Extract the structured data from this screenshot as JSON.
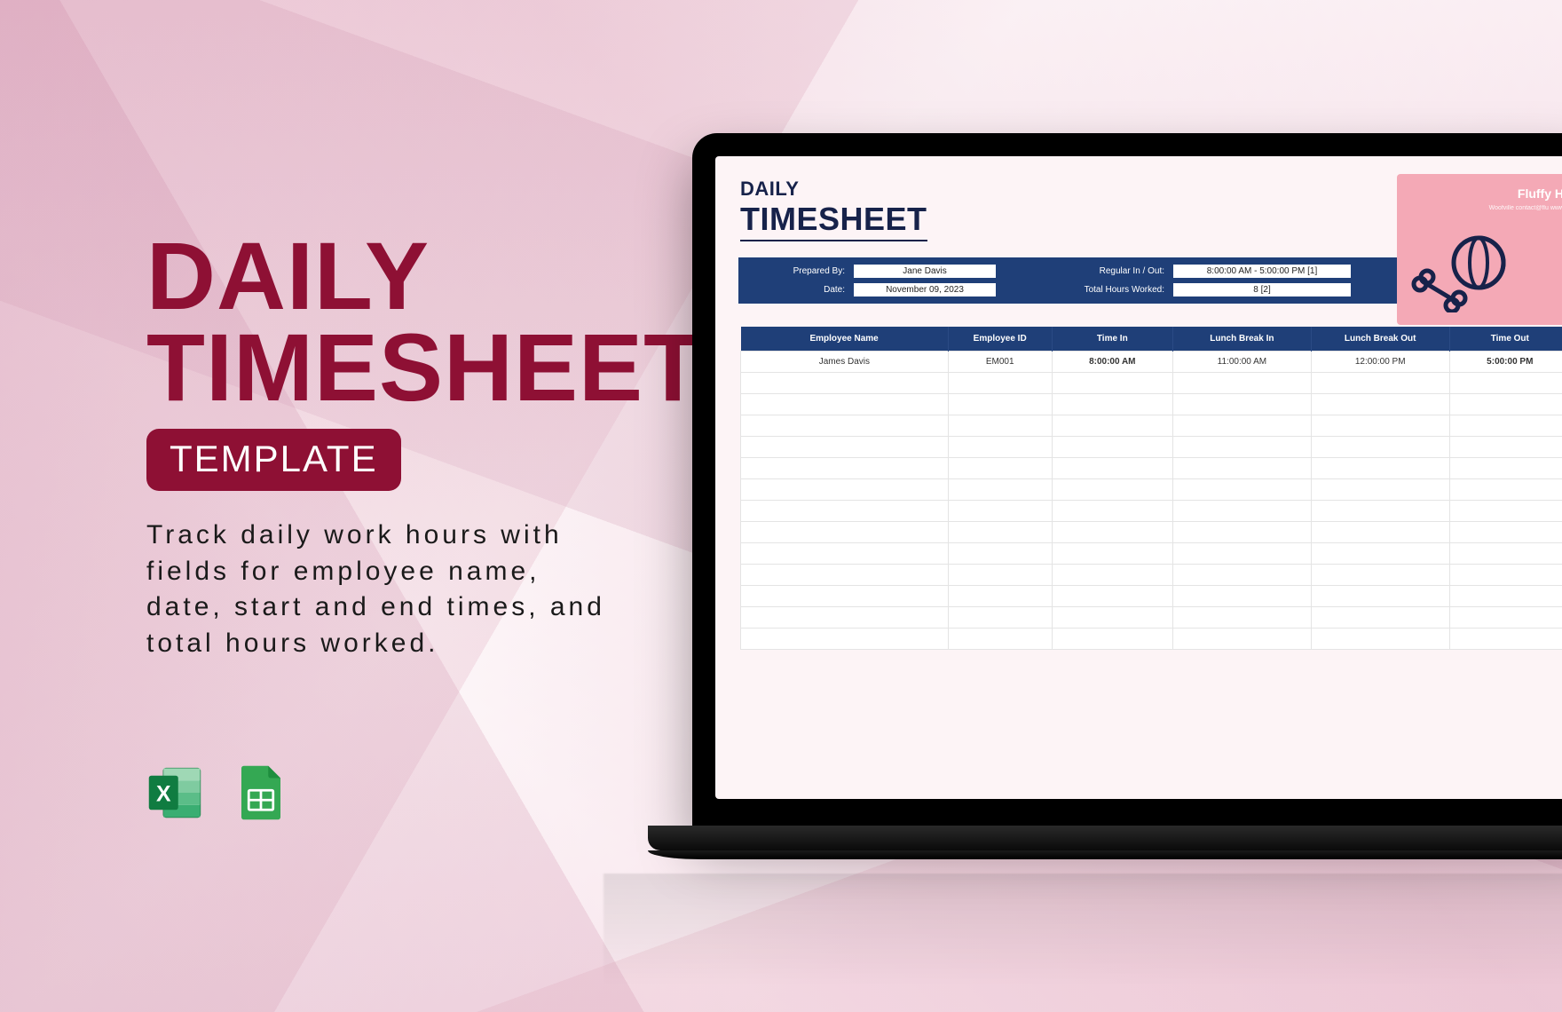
{
  "hero": {
    "line1": "DAILY",
    "line2": "TIMESHEET",
    "badge": "TEMPLATE",
    "description": "Track daily work hours with fields for employee name, date, start and end times, and total hours worked."
  },
  "icons": {
    "excel": "excel-icon",
    "sheets": "google-sheets-icon"
  },
  "spreadsheet": {
    "title_small": "DAILY",
    "title_big": "TIMESHEET",
    "prepared_by_label": "Prepared By:",
    "prepared_by": "Jane Davis",
    "date_label": "Date:",
    "date": "November 09, 2023",
    "regular_label": "Regular In / Out:",
    "regular": "8:00:00 AM - 5:00:00 PM [1]",
    "total_hours_label": "Total Hours Worked:",
    "total_hours": "8 [2]",
    "brand_title": "Fluffy H",
    "brand_sub": "Woofville\ncontact@flu\nwww",
    "columns": [
      "Employee Name",
      "Employee ID",
      "Time In",
      "Lunch Break In",
      "Lunch Break Out",
      "Time Out"
    ],
    "rows": [
      {
        "name": "James Davis",
        "id": "EM001",
        "time_in": "8:00:00 AM",
        "lunch_in": "11:00:00 AM",
        "lunch_out": "12:00:00 PM",
        "time_out": "5:00:00 PM"
      }
    ]
  },
  "colors": {
    "brand": "#8e1034",
    "navy": "#1f3f78",
    "pink": "#f4a9b6"
  }
}
